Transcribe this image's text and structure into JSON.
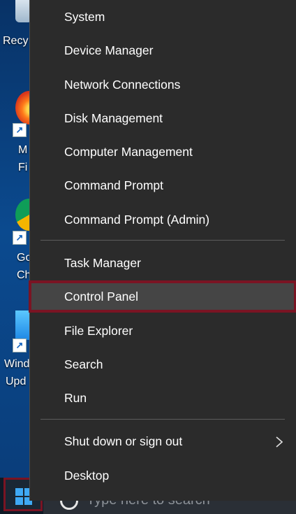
{
  "desktop": {
    "icons": [
      {
        "label_line1": "Recy",
        "label_line2": ""
      },
      {
        "label_line1": "M",
        "label_line2": "Fi"
      },
      {
        "label_line1": "Go",
        "label_line2": "Ch"
      },
      {
        "label_line1": "Wind",
        "label_line2": "Upd"
      }
    ]
  },
  "menu": {
    "group1": [
      {
        "label": "System"
      },
      {
        "label": "Device Manager"
      },
      {
        "label": "Network Connections"
      },
      {
        "label": "Disk Management"
      },
      {
        "label": "Computer Management"
      },
      {
        "label": "Command Prompt"
      },
      {
        "label": "Command Prompt (Admin)"
      }
    ],
    "group2": [
      {
        "label": "Task Manager"
      },
      {
        "label": "Control Panel",
        "highlighted": true
      },
      {
        "label": "File Explorer"
      },
      {
        "label": "Search"
      },
      {
        "label": "Run"
      }
    ],
    "group3": [
      {
        "label": "Shut down or sign out",
        "has_submenu": true
      },
      {
        "label": "Desktop"
      }
    ]
  },
  "taskbar": {
    "search_placeholder": "Type here to search"
  },
  "colors": {
    "menu_bg": "#2b2b2b",
    "highlight_bg": "#454545",
    "highlight_border": "#7a1423",
    "text": "#ffffff"
  }
}
